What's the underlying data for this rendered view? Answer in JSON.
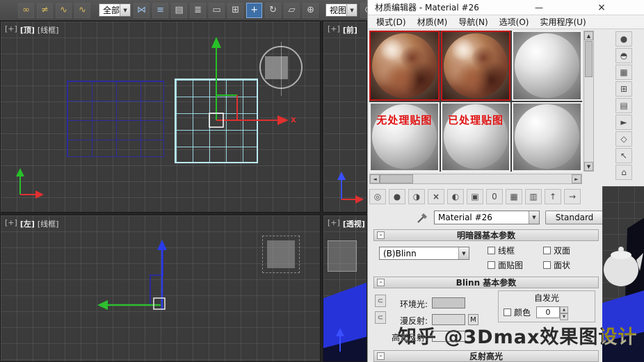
{
  "glyphs": {
    "up": "▲",
    "down": "▼",
    "left": "◄",
    "right": "►",
    "dropdown": "▼",
    "collapse": "-",
    "lock": "⊂",
    "spin_up": "▲",
    "spin_down": "▼"
  },
  "main_toolbar": {
    "filter_value": "全部",
    "coord_value": "视图",
    "icons_a": [
      {
        "name": "select-and-link-icon",
        "glyph": "∞",
        "cls": "gold"
      },
      {
        "name": "unlink-selection-icon",
        "glyph": "≠",
        "cls": "gold"
      },
      {
        "name": "bind-to-space-warp-icon",
        "glyph": "∿",
        "cls": "gold"
      },
      {
        "name": "curve-constraint-icon",
        "glyph": "∿",
        "cls": "gold"
      }
    ],
    "icons_b": [
      {
        "name": "mirror-icon",
        "glyph": "⋈",
        "cls": "bluegray"
      },
      {
        "name": "align-icon",
        "glyph": "≡",
        "cls": "bluegray"
      },
      {
        "name": "layer-manager-icon",
        "glyph": "▤"
      },
      {
        "name": "select-by-name-icon",
        "glyph": "≣"
      },
      {
        "name": "rect-selection-region-icon",
        "glyph": "▭"
      },
      {
        "name": "window-crossing-icon",
        "glyph": "⊞"
      },
      {
        "name": "select-and-move-icon",
        "glyph": "+",
        "cls": "active-dark"
      },
      {
        "name": "select-and-rotate-icon",
        "glyph": "↻"
      },
      {
        "name": "select-and-scale-icon",
        "glyph": "▱"
      },
      {
        "name": "select-and-place-icon",
        "glyph": "⊕"
      }
    ],
    "icons_c": [
      {
        "name": "pivot-center-icon",
        "glyph": "⊙"
      }
    ]
  },
  "viewports": {
    "top_left": {
      "overflow": "[+]",
      "name": "[顶]",
      "shading": "[线框]",
      "gizmo_axis_label": "x"
    },
    "top_right": {
      "overflow": "[+]",
      "name": "[前]"
    },
    "bottom_left": {
      "overflow": "[+]",
      "name": "[左]",
      "shading": "[线框]"
    },
    "bottom_right": {
      "overflow": "[+]",
      "name": "[透视]"
    }
  },
  "material_editor": {
    "title": "材质编辑器 - Material #26",
    "minimize_glyph": "—",
    "close_glyph": "×",
    "menu_items": [
      "模式(D)",
      "材质(M)",
      "导航(N)",
      "选项(O)",
      "实用程序(U)"
    ],
    "slot_overlay_unprocessed": "无处理贴图",
    "slot_overlay_processed": "已处理贴图",
    "slot_tools": [
      {
        "name": "sample-type-icon",
        "glyph": "●"
      },
      {
        "name": "backlight-icon",
        "glyph": "◓",
        "cls": "active-light"
      },
      {
        "name": "background-icon",
        "glyph": "▦"
      },
      {
        "name": "sample-uv-tiling-icon",
        "glyph": "⊞"
      },
      {
        "name": "video-color-check-icon",
        "glyph": "▤"
      },
      {
        "name": "make-preview-icon",
        "glyph": "►"
      },
      {
        "name": "options-icon",
        "glyph": "◇"
      },
      {
        "name": "select-by-material-icon",
        "glyph": "↖"
      },
      {
        "name": "material-map-navigator-icon",
        "glyph": "⌂"
      }
    ],
    "material_tools": [
      {
        "name": "get-material-icon",
        "glyph": "◎"
      },
      {
        "name": "put-material-to-scene-icon",
        "glyph": "●"
      },
      {
        "name": "assign-material-to-selection-icon",
        "glyph": "◑"
      },
      {
        "name": "reset-map-icon",
        "glyph": "×",
        "cls": "red"
      },
      {
        "name": "make-material-copy-icon",
        "glyph": "◐"
      },
      {
        "name": "put-to-library-icon",
        "glyph": "▣"
      },
      {
        "name": "material-id-channel-icon",
        "glyph": "0"
      },
      {
        "name": "show-map-in-viewport-icon",
        "glyph": "▦",
        "cls": "active-light"
      },
      {
        "name": "show-end-result-icon",
        "glyph": "▥"
      },
      {
        "name": "go-to-parent-icon",
        "glyph": "↑",
        "cls": "blueicon"
      },
      {
        "name": "go-forward-sibling-icon",
        "glyph": "→",
        "cls": "blueicon"
      }
    ],
    "material_name": "Material #26",
    "material_type": "Standard",
    "rollout_shader": {
      "state": "-",
      "title": "明暗器基本参数",
      "shader": "(B)Blinn",
      "cb_wire": "线框",
      "cb_two_sided": "双面",
      "cb_face_map": "面贴图",
      "cb_faceted": "面状"
    },
    "rollout_blinn": {
      "state": "-",
      "title": "Blinn 基本参数",
      "ambient": "环境光:",
      "diffuse": "漫反射:",
      "specular": "高光反射:",
      "self_illum": "自发光",
      "color_cb": "颜色",
      "self_illum_value": "0",
      "map_btn": "M"
    },
    "rollout_specular": {
      "state": "-",
      "title": "反射高光"
    }
  },
  "watermark": "知乎 @3Dmax效果图设计"
}
